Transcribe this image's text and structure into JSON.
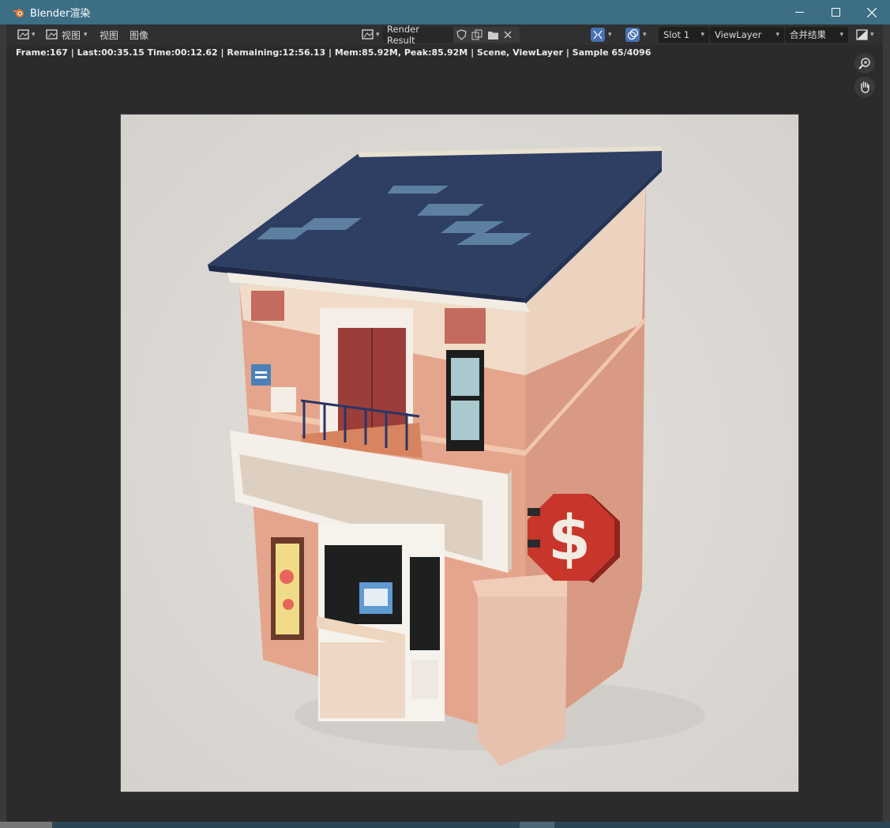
{
  "window": {
    "title": "Blender渲染",
    "minimize_icon": "minimize-icon",
    "maximize_icon": "maximize-icon",
    "close_icon": "close-icon"
  },
  "header": {
    "editor_type_icon": "image-editor-icon",
    "menus": [
      "视图",
      "视图",
      "图像"
    ],
    "image_name": "Render Result",
    "slot": "Slot 1",
    "view_layer": "ViewLayer",
    "pass": "合并结果"
  },
  "status": {
    "text": "Frame:167 | Last:00:35.15 Time:00:12.62 | Remaining:12:56.13 | Mem:85.92M, Peak:85.92M | Scene, ViewLayer | Sample 65/4096"
  },
  "nav": {
    "zoom_icon": "zoom-icon",
    "pan_icon": "hand-pan-icon"
  },
  "colors": {
    "title_bar": "#3c6e86",
    "roof": "#2e3f63",
    "wall": "#e3a48b",
    "sign": "#c8352a",
    "background": "#dcd9d5"
  }
}
